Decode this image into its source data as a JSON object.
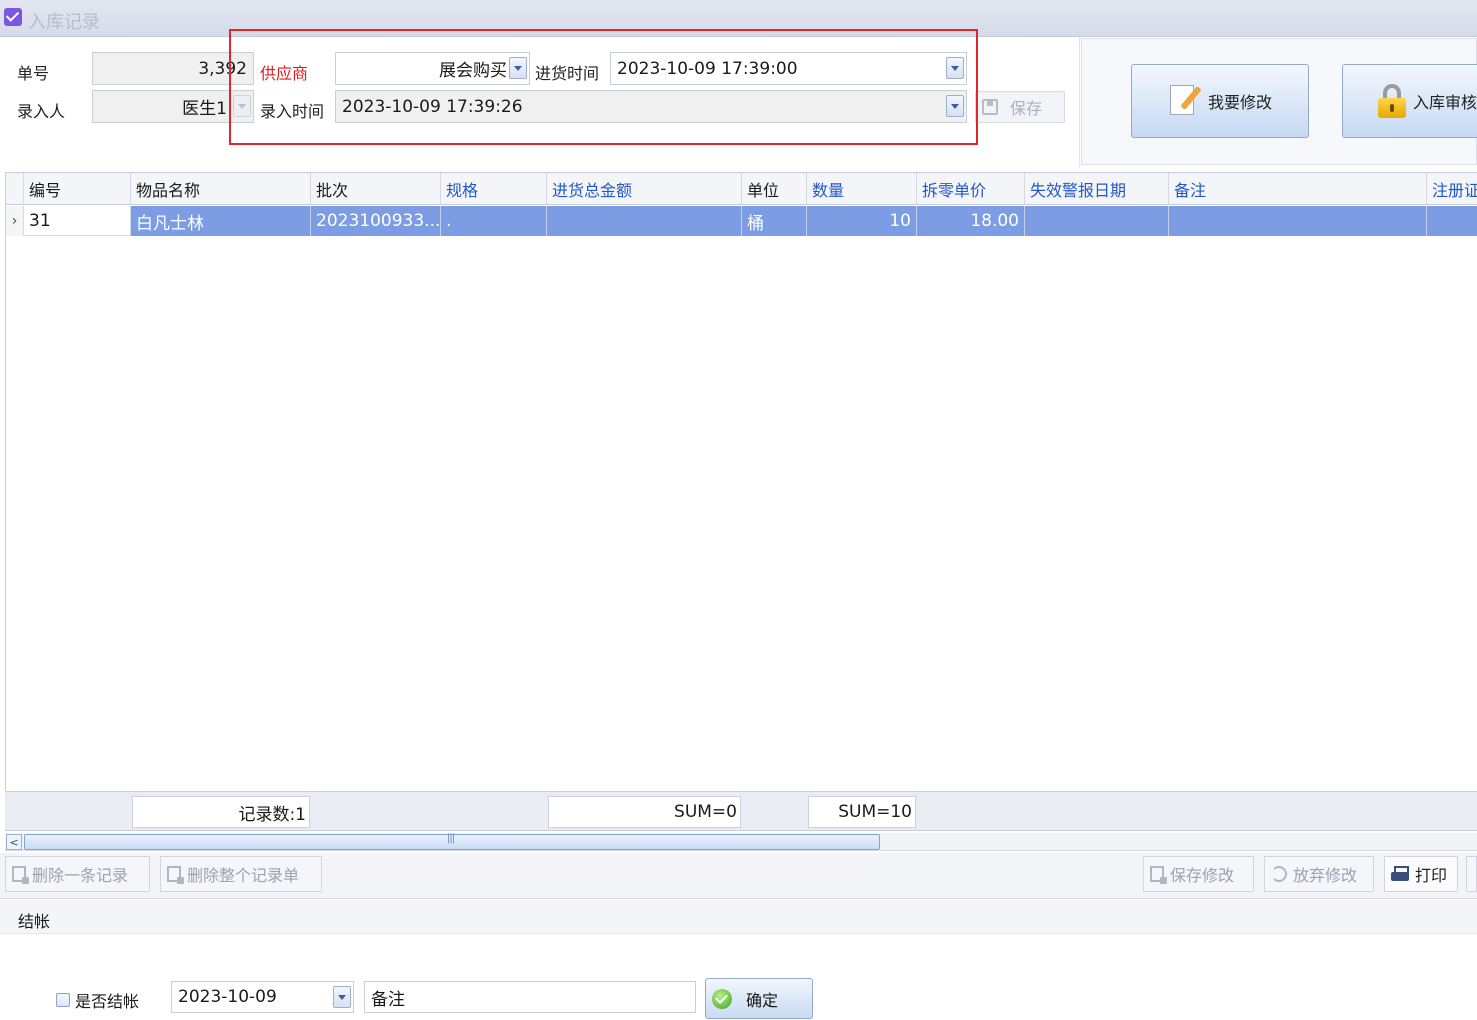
{
  "window": {
    "title": "入库记录"
  },
  "form": {
    "order_no_label": "单号",
    "order_no_value": "3,392",
    "supplier_label": "供应商",
    "supplier_value": "展会购买",
    "purchase_time_label": "进货时间",
    "purchase_time_value": "2023-10-09 17:39:00",
    "entered_by_label": "录入人",
    "entered_by_value": "医生1",
    "entry_time_label": "录入时间",
    "entry_time_value": "2023-10-09 17:39:26",
    "save_label": "保存"
  },
  "actions": {
    "modify_label": "我要修改",
    "audit_label": "入库审核"
  },
  "grid": {
    "columns": [
      {
        "label": "编号",
        "highlight": false
      },
      {
        "label": "物品名称",
        "highlight": false
      },
      {
        "label": "批次",
        "highlight": false
      },
      {
        "label": "规格",
        "highlight": true
      },
      {
        "label": "进货总金额",
        "highlight": true
      },
      {
        "label": "单位",
        "highlight": false
      },
      {
        "label": "数量",
        "highlight": true
      },
      {
        "label": "拆零单价",
        "highlight": true
      },
      {
        "label": "失效警报日期",
        "highlight": true
      },
      {
        "label": "备注",
        "highlight": true
      },
      {
        "label": "注册证",
        "highlight": true
      }
    ],
    "rows": [
      {
        "id": "31",
        "name": "白凡士林",
        "batch": "2023100933...",
        "spec": ".",
        "total_amount": "",
        "unit": "桶",
        "quantity": "10",
        "unit_price": "18.00",
        "expiry_alert": "",
        "remark": "",
        "registration": ""
      }
    ]
  },
  "footer": {
    "record_count": "记录数:1",
    "sum_amount": "SUM=0",
    "sum_quantity": "SUM=10"
  },
  "toolbar": {
    "delete_one": "删除一条记录",
    "delete_all": "删除整个记录单",
    "save_changes": "保存修改",
    "discard_changes": "放弃修改",
    "print": "打印"
  },
  "settle": {
    "section_title": "结帐",
    "checkbox_label": "是否结帐",
    "date_value": "2023-10-09",
    "remark_value": "备注",
    "confirm_label": "确定"
  },
  "colors": {
    "accent": "#7c9ce3",
    "highlight_header": "#2458c7",
    "required_label": "#e01b1b",
    "annotation_box": "#e0262c"
  }
}
